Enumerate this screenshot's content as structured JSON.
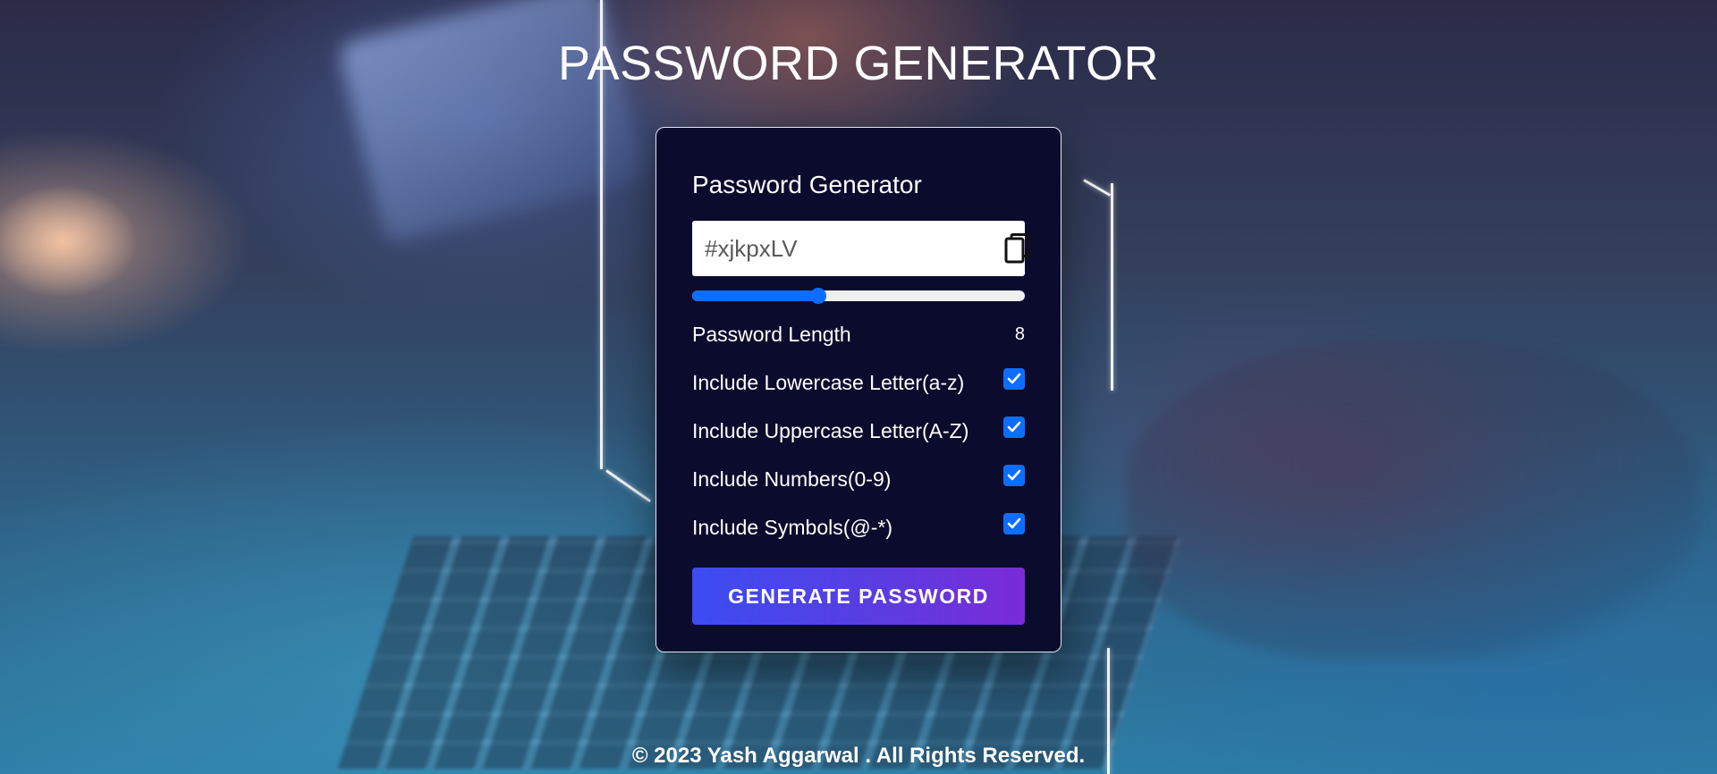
{
  "page": {
    "title": "PASSWORD GENERATOR",
    "footer": "© 2023 Yash Aggarwal . All Rights Reserved."
  },
  "card": {
    "title": "Password Generator",
    "password_value": "#xjkpxLV",
    "copy_icon": "copy-icon",
    "length_label": "Password Length",
    "length_value": "8",
    "length_slider_fraction": 0.38,
    "options": [
      {
        "label": "Include Lowercase Letter(a-z)",
        "checked": true
      },
      {
        "label": "Include Uppercase Letter(A-Z)",
        "checked": true
      },
      {
        "label": "Include Numbers(0-9)",
        "checked": true
      },
      {
        "label": "Include Symbols(@-*)",
        "checked": true
      }
    ],
    "generate_label": "GENERATE PASSWORD"
  },
  "colors": {
    "card_background": "#0b0b2e",
    "accent": "#0d6efd",
    "button_gradient_start": "#3b4cf2",
    "button_gradient_end": "#7a2bd8"
  }
}
